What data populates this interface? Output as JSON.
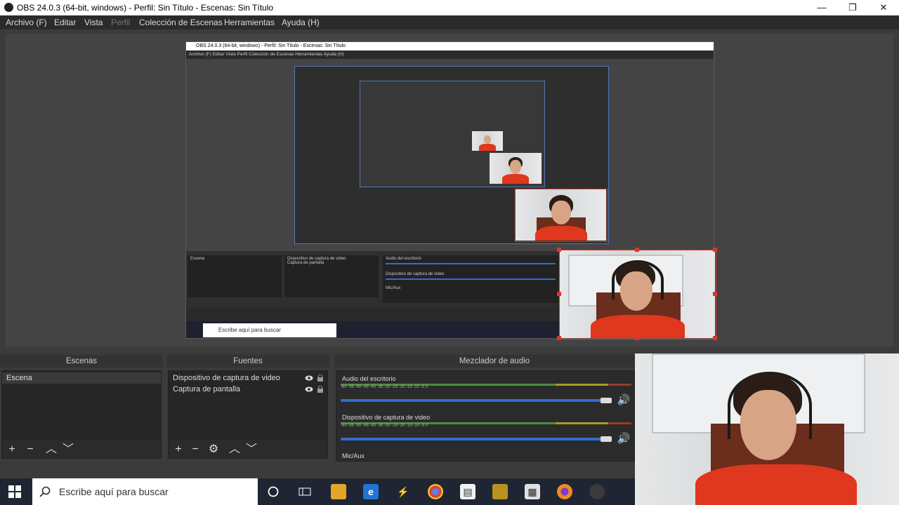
{
  "window": {
    "title": "OBS 24.0.3 (64-bit, windows) - Perfil: Sin Título - Escenas: Sin Título",
    "minimize": "—",
    "restore": "❐",
    "close": "✕"
  },
  "menu": [
    "Archivo (F)",
    "Editar",
    "Vista",
    "Perfil",
    "Colección de Escenas",
    "Herramientas",
    "Ayuda (H)"
  ],
  "nested": {
    "title": "OBS 24.0.3 (64-bit, windows) - Perfil: Sin Título - Escenas: Sin Título",
    "menu": "Archivo (F)   Editar   Vista   Perfil   Colección de Escenas   Herramientas   Ayuda (H)",
    "search": "Escribe aquí para buscar",
    "docks": {
      "scenes": "Escenas",
      "sources": "Fuentes",
      "mixer": "Mezclador de audio",
      "scene_item": "Escena",
      "source1": "Dispositivo de captura de video",
      "source2": "Captura de pantalla",
      "audio1": "Audio del escritorio",
      "audio2": "Dispositivo de captura de video",
      "mic": "Mic/Aux"
    }
  },
  "docks": {
    "scenes": {
      "title": "Escenas",
      "items": [
        "Escena"
      ]
    },
    "sources": {
      "title": "Fuentes",
      "items": [
        "Dispositivo de captura de video",
        "Captura de pantalla"
      ]
    },
    "mixer": {
      "title": "Mezclador de audio",
      "channels": [
        {
          "name": "Audio del escritorio",
          "volume": 0.92
        },
        {
          "name": "Dispositivo de captura de video",
          "volume": 0.92
        }
      ],
      "mic": "Mic/Aux",
      "ticks": "-60   -55   -50   -45   -40   -35   -30   -25   -20   -15   -10   -5   0"
    }
  },
  "toolbar_icons": {
    "add": "+",
    "remove": "−",
    "up": "︿",
    "down": "﹀",
    "gear": "⚙"
  },
  "taskbar": {
    "search_placeholder": "Escribe aquí para buscar"
  },
  "colors": {
    "selection": "#e0342b",
    "accent": "#2e6fd1",
    "taskbar": "#1f2532"
  }
}
